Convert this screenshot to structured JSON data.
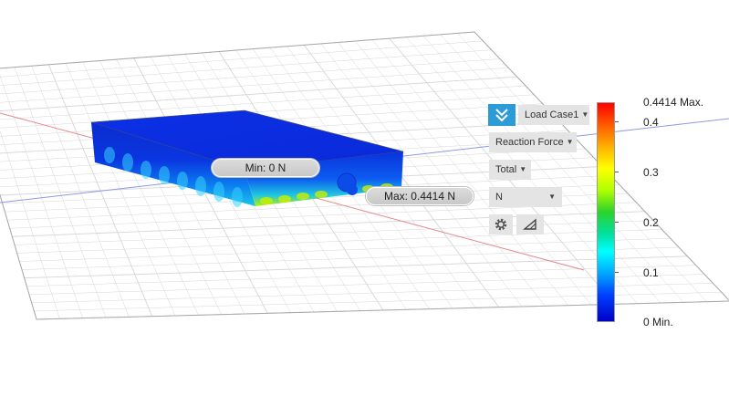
{
  "viewport": {
    "min_label": "Min: 0 N",
    "max_label": "Max: 0.4414 N"
  },
  "toolbar": {
    "load_case": "Load Case1",
    "result_type": "Reaction Force",
    "component": "Total",
    "unit": "N",
    "check_icon": "double-chevron-check-icon",
    "settings_icon": "gear-icon",
    "surface_icon": "triangle-ruler-icon"
  },
  "legend": {
    "max": "0.4414 Max.",
    "ticks": [
      "0.4",
      "0.3",
      "0.2",
      "0.1"
    ],
    "min": "0 Min.",
    "top_color": "#ff0000",
    "bottom_color": "#0000c8"
  },
  "colors": {
    "accent": "#2d9bd8",
    "body": "#0a2fe0",
    "grid": "#d6d6d6"
  }
}
